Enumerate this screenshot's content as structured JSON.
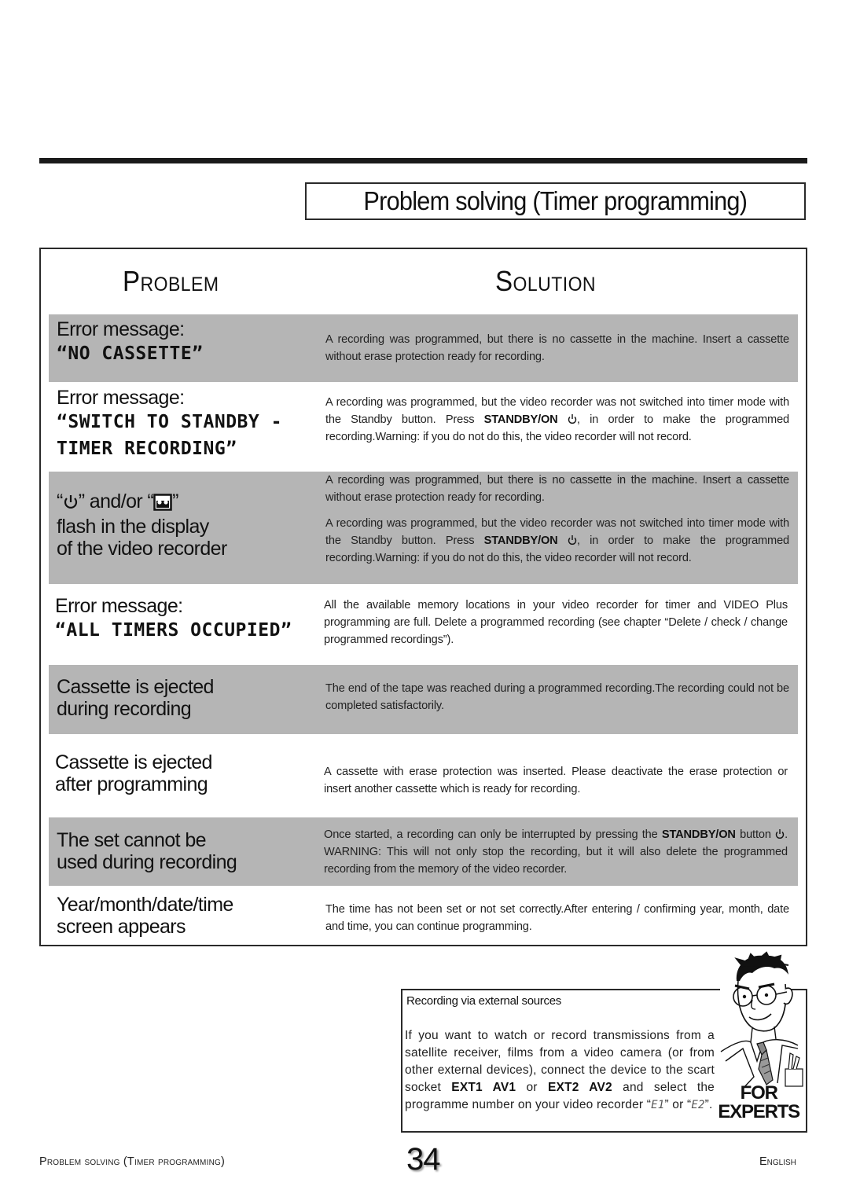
{
  "page": {
    "title": "Problem solving (Timer programming)",
    "page_number": "34",
    "footer_left": "Problem solving (Timer programming)",
    "footer_right": "English"
  },
  "table": {
    "header_problem": "Problem",
    "header_solution": "Solution",
    "rows": [
      {
        "shaded": true,
        "problem_lines": [
          "Error message:",
          "“NO CASSETTE”"
        ],
        "solution": [
          "A recording was programmed, but there is no cassette in the machine. Insert a cassette without erase protection ready for recording."
        ]
      },
      {
        "shaded": false,
        "problem_lines": [
          "Error message:",
          "“SWITCH TO STANDBY -",
          "TIMER RECORDING”"
        ],
        "solution_pre": "A recording was programmed, but the video recorder was not switched into timer mode with the Standby button. Press ",
        "solution_bold": "STANDBY/ON",
        "solution_post": ", in order to make the programmed recording.Warning: if you do not do this, the video recorder will not record."
      },
      {
        "shaded": true,
        "problem_line1_a": "“",
        "problem_line1_b": "” and/or “",
        "problem_line1_c": "”",
        "problem_lines": [
          "flash in the display",
          "of the video recorder"
        ],
        "solution_p1": "A recording was programmed, but there is no cassette in the machine. Insert a cassette without erase protection ready for recording.",
        "solution_p2_pre": "A recording was programmed, but the video recorder was not switched into timer mode with the Standby button. Press ",
        "solution_p2_bold": "STANDBY/ON",
        "solution_p2_post": ", in order to make the programmed recording.Warning: if you do not do this, the video recorder will not record.",
        "icons": [
          "timer-power-icon",
          "cassette-icon"
        ]
      },
      {
        "shaded": false,
        "problem_lines": [
          "Error message:",
          "“ALL TIMERS OCCUPIED”"
        ],
        "solution": [
          "All the available memory locations in your video recorder for timer and VIDEO Plus programming are full. Delete a programmed recording (see chapter “Delete / check / change programmed recordings”)."
        ]
      },
      {
        "shaded": true,
        "problem_lines": [
          "Cassette is ejected",
          "during recording"
        ],
        "solution": [
          "The end of the tape was reached during a programmed recording.The recording could not be completed satisfactorily."
        ]
      },
      {
        "shaded": false,
        "problem_lines": [
          "Cassette is ejected",
          "after programming"
        ],
        "solution": [
          "A cassette with erase protection was inserted. Please deactivate the erase protection or insert another cassette which is ready for recording."
        ]
      },
      {
        "shaded": true,
        "problem_lines": [
          "The set cannot be",
          "used during recording"
        ],
        "solution_pre": "Once started, a recording can only be interrupted by pressing the ",
        "solution_bold": "STANDBY/ON",
        "solution_mid": " button ",
        "solution_post": ".  WARNING: This will not only stop the recording, but it will also delete the programmed recording from the memory of the video recorder."
      },
      {
        "shaded": false,
        "problem_lines": [
          "Year/month/date/time",
          "screen appears"
        ],
        "solution": [
          "The time has not been set or not set correctly.After entering / confirming year, month, date and time, you can continue programming."
        ]
      }
    ]
  },
  "experts": {
    "title": "Recording via external sources",
    "body_1": "If you want to watch or record transmissions from a satellite receiver, films from a video camera (or from other external devices), connect the device to the scart socket ",
    "bold_1": "EXT1 AV1",
    "body_2": " or ",
    "bold_2": "EXT2 AV2",
    "body_3": " and select the programme number on your video recorder “",
    "lcd_1": "E1",
    "body_4": "” or “",
    "lcd_2": "E2",
    "body_5": "”.",
    "badge_line1": "FOR",
    "badge_line2": "EXPERTS",
    "illustration": "expert-character-illustration"
  }
}
